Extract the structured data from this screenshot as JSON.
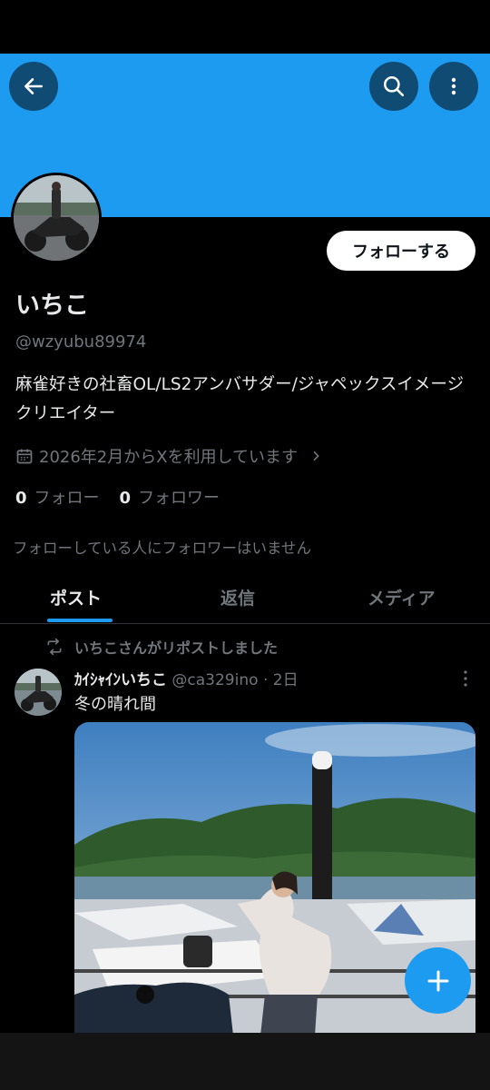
{
  "profile": {
    "name": "いちこ",
    "handle": "@wzyubu89974",
    "bio": "麻雀好きの社畜OL/LS2アンバサダー/ジャペックスイメージクリエイター",
    "joined": "2026年2月からXを利用しています",
    "following_count": "0",
    "following_label": "フォロー",
    "followers_count": "0",
    "followers_label": "フォロワー",
    "no_followers_note": "フォローしている人にフォロワーはいません",
    "follow_button": "フォローする"
  },
  "tabs": [
    {
      "label": "ポスト",
      "active": true
    },
    {
      "label": "返信",
      "active": false
    },
    {
      "label": "メディア",
      "active": false
    }
  ],
  "post": {
    "repost_note": "いちこさんがリポストしました",
    "author_name": "ｶｲｼｬｲﾝいちこ",
    "author_handle": "@ca329ino",
    "time": "2日",
    "text": "冬の晴れ間"
  },
  "colors": {
    "accent": "#1d9bf0",
    "background": "#000000",
    "secondary_text": "#71767b"
  },
  "icons": {
    "back": "arrow-left-icon",
    "search": "search-icon",
    "more": "more-vertical-icon",
    "calendar": "calendar-icon",
    "repost": "repost-icon",
    "compose": "plus-icon"
  }
}
